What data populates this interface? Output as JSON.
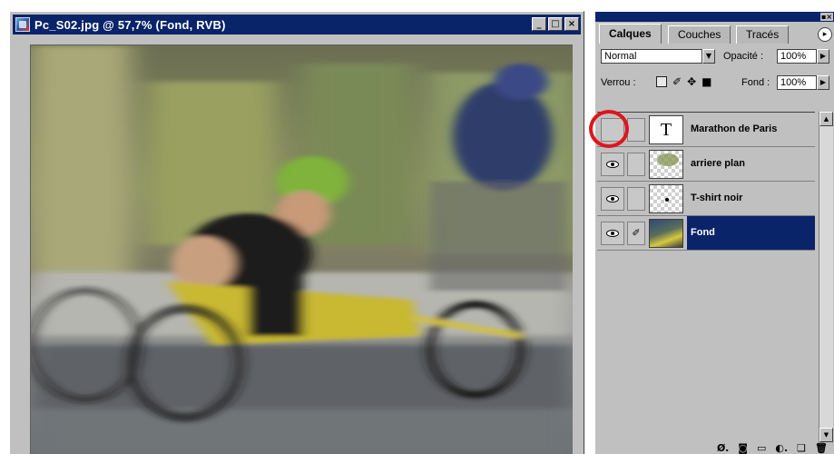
{
  "document": {
    "title": "Pc_S02.jpg @ 57,7% (Fond, RVB)",
    "window_buttons": {
      "minimize": "_",
      "maximize": "□",
      "close": "×"
    }
  },
  "palette": {
    "tabs": [
      {
        "label": "Calques",
        "active": true
      },
      {
        "label": "Couches",
        "active": false
      },
      {
        "label": "Tracés",
        "active": false
      }
    ],
    "menu_arrow": "▸",
    "blend_mode": "Normal",
    "opacity_label": "Opacité :",
    "opacity_value": "100%",
    "lock_label": "Verrou :",
    "fill_label": "Fond :",
    "fill_value": "100%",
    "layers": [
      {
        "name": "Marathon de Paris",
        "visible": false,
        "thumbnail": "text-layer-icon",
        "thumb_glyph": "T",
        "selected": false
      },
      {
        "name": "arriere plan",
        "visible": true,
        "thumbnail": "transparent-checker",
        "selected": false
      },
      {
        "name": "T-shirt noir",
        "visible": true,
        "thumbnail": "transparent-checker",
        "selected": false
      },
      {
        "name": "Fond",
        "visible": true,
        "thumbnail": "photo",
        "brush": "✐",
        "selected": true
      }
    ],
    "bottom_icons": [
      "styles-icon",
      "mask-icon",
      "folder-icon",
      "adjustment-icon",
      "new-layer-icon",
      "trash-icon"
    ],
    "bottom_glyphs": [
      "Ø.",
      "◙",
      "▭",
      "◐.",
      "❑",
      "🗑"
    ]
  },
  "colors": {
    "titlebar": "#0a246a",
    "selection": "#0a246a",
    "chrome": "#c0c0c0",
    "highlight_circle": "#e0141e"
  }
}
